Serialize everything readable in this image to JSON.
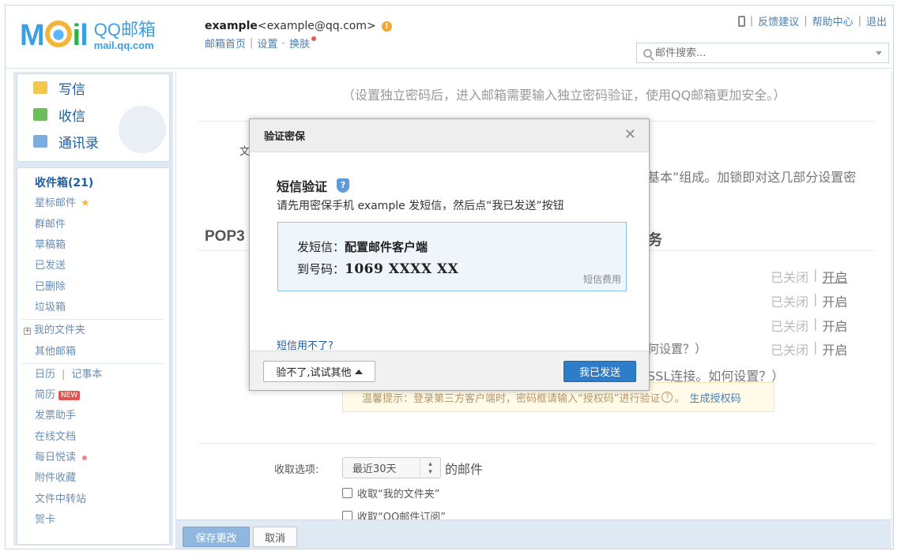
{
  "header": {
    "logo_text": "MOil",
    "brand_name": "QQ邮箱",
    "brand_domain": "mail.qq.com",
    "account_name": "example",
    "account_email": "<example@qq.com>",
    "links": [
      "邮箱首页",
      "设置",
      "换肤"
    ],
    "toplinks": [
      "反馈建议",
      "帮助中心",
      "退出"
    ],
    "search_placeholder": "邮件搜索..."
  },
  "sidebar": {
    "quick": [
      "写信",
      "收信",
      "通讯录"
    ],
    "folders": [
      {
        "label": "收件箱(21)",
        "bold": true
      },
      {
        "label": "星标邮件"
      },
      {
        "label": "群邮件"
      },
      {
        "label": "草稿箱"
      },
      {
        "label": "已发送"
      },
      {
        "label": "已删除"
      },
      {
        "label": "垃圾箱"
      }
    ],
    "my_folders": "我的文件夹",
    "other_mail": "其他邮箱",
    "calendar": "日历",
    "notes": "记事本",
    "apps": [
      "简历",
      "发票助手",
      "在线文档",
      "每日悦读",
      "附件收藏",
      "文件中转站",
      "贺卡"
    ],
    "new_badge": "NEW"
  },
  "main": {
    "note1": "（设置独立密码后，进入邮箱需要输入独立密码验证，使用QQ邮箱更加安全。）",
    "file_label": "文",
    "basic_text": "基本”组成。加锁即对这几部分设置密",
    "pop3_title": "POP3",
    "pop3_tail": "务",
    "service_rows": [
      {
        "closed": "已关闭",
        "action": "开启"
      },
      {
        "closed": "已关闭",
        "action": "开启"
      },
      {
        "closed": "已关闭",
        "action": "开启"
      },
      {
        "closed": "已关闭",
        "action": "开启"
      }
    ],
    "hint1": "何设置？）",
    "hint2": "SSL连接。如何设置？）",
    "tip_text": "温馨提示：登录第三方客户端时，密码框请输入“授权码”进行验证",
    "tip_link": "生成授权码",
    "recv_label": "收取选项:",
    "recv_value": "最近30天",
    "recv_suffix": "的邮件",
    "checkbox1": "收取“我的文件夹”",
    "checkbox2": "收取“QQ邮件订阅”",
    "save": "保存更改",
    "cancel": "取消"
  },
  "dialog": {
    "title": "验证密保",
    "heading": "短信验证",
    "desc": "请先用密保手机 example 发短信，然后点“我已发送”按钮",
    "send_label": "发短信：",
    "send_value": "配置邮件客户端",
    "to_label": "到号码：",
    "to_value": "1069 XXXX XX",
    "fee": "短信费用",
    "cant_use": "短信用不了?",
    "try_other": "验不了,试试其他",
    "sent": "我已发送"
  }
}
